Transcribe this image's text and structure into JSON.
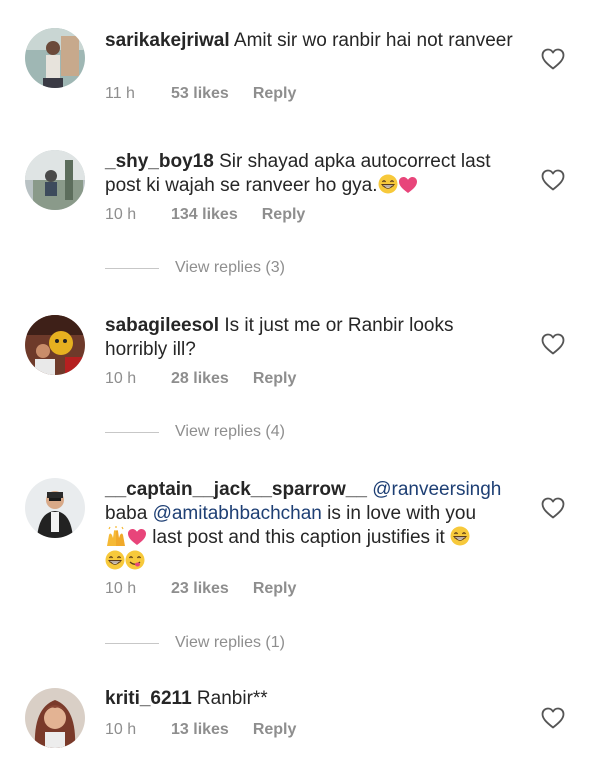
{
  "comments": [
    {
      "username": "sarikakejriwal",
      "text_1": "Amit sir wo ranbir hai not ranveer",
      "time": "11 h",
      "likes": "53 likes",
      "reply": "Reply"
    },
    {
      "username": "_shy_boy18",
      "text_1": "Sir shayad apka autocorrect last post ki wajah se ranveer ho gya.",
      "time": "10 h",
      "likes": "134 likes",
      "reply": "Reply",
      "view_replies": "View replies (3)"
    },
    {
      "username": "sabagileesol",
      "text_1": "Is it just me or Ranbir looks horribly ill?",
      "time": "10 h",
      "likes": "28 likes",
      "reply": "Reply",
      "view_replies": "View replies (4)"
    },
    {
      "username": "__captain__jack__sparrow__",
      "mention_1": "@ranveersingh",
      "text_1": "baba",
      "mention_2": "@amitabhbachchan",
      "text_2": "is in love with you",
      "text_3": "last post and this caption justifies it",
      "time": "10 h",
      "likes": "23 likes",
      "reply": "Reply",
      "view_replies": "View replies (1)"
    },
    {
      "username": "kriti_6211",
      "text_1": "Ranbir**",
      "time": "10 h",
      "likes": "13 likes",
      "reply": "Reply"
    }
  ],
  "colors": {
    "text": "#262626",
    "meta": "#8e8e8e",
    "mention": "#1e3f74",
    "heart_emoji": "#e8457a"
  },
  "icons": {
    "like": "heart-outline-icon",
    "emoji_grin": "grinning-face-emoji",
    "emoji_heart": "pink-heart-emoji",
    "emoji_hands": "raising-hands-emoji",
    "emoji_yum": "savoring-face-emoji"
  }
}
